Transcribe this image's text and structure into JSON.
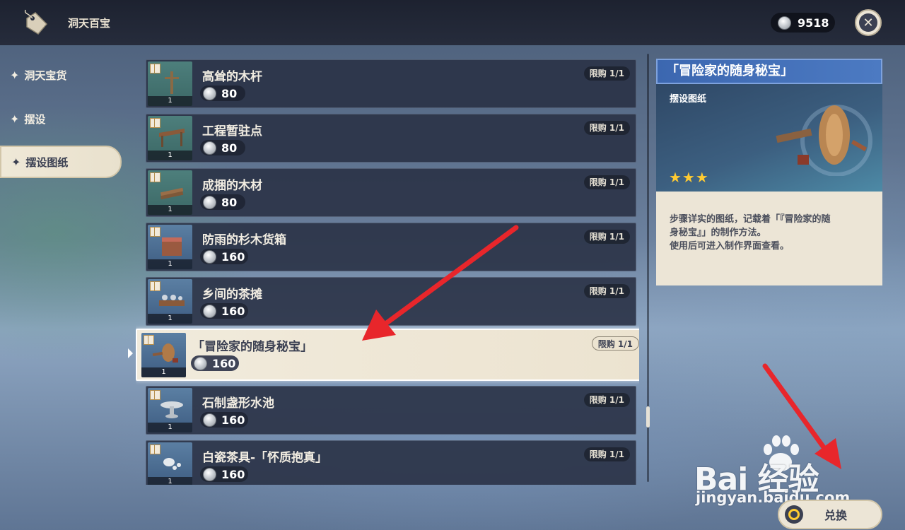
{
  "header": {
    "title": "洞天百宝",
    "currency_value": "9518",
    "close_symbol": "✕"
  },
  "sidebar": {
    "items": [
      {
        "label": "洞天宝货",
        "active": false
      },
      {
        "label": "摆设",
        "active": false
      },
      {
        "label": "摆设图纸",
        "active": true
      }
    ]
  },
  "list": {
    "items": [
      {
        "name": "高耸的木杆",
        "price": "80",
        "limit": "限购 1/1",
        "count": "1",
        "selected": false
      },
      {
        "name": "工程暂驻点",
        "price": "80",
        "limit": "限购 1/1",
        "count": "1",
        "selected": false
      },
      {
        "name": "成捆的木材",
        "price": "80",
        "limit": "限购 1/1",
        "count": "1",
        "selected": false
      },
      {
        "name": "防雨的杉木货箱",
        "price": "160",
        "limit": "限购 1/1",
        "count": "1",
        "selected": false
      },
      {
        "name": "乡间的茶摊",
        "price": "160",
        "limit": "限购 1/1",
        "count": "1",
        "selected": false
      },
      {
        "name": "「冒险家的随身秘宝」",
        "price": "160",
        "limit": "限购 1/1",
        "count": "1",
        "selected": true
      },
      {
        "name": "石制盏形水池",
        "price": "160",
        "limit": "限购 1/1",
        "count": "1",
        "selected": false
      },
      {
        "name": "白瓷茶具-「怀质抱真」",
        "price": "160",
        "limit": "限购 1/1",
        "count": "1",
        "selected": false
      }
    ]
  },
  "detail": {
    "title": "「冒险家的随身秘宝」",
    "type": "摆设图纸",
    "rarity_stars": 3,
    "stars_text": "★★★",
    "description_line1": "步骤详实的图纸，记载着「『冒险家的随",
    "description_line2": "身秘宝』」的制作方法。",
    "description_line3": "使用后可进入制作界面查看。"
  },
  "footer": {
    "exchange_label": "兑换"
  },
  "watermark": {
    "brand": "Bai  经验",
    "url": "jingyan.baidu.com"
  },
  "colors": {
    "accent_blue": "#3c67b0",
    "panel_cream": "#ece5d6",
    "dark_slate": "#3b4052",
    "star_gold": "#ffcb32",
    "arrow_red": "#e8262b"
  }
}
